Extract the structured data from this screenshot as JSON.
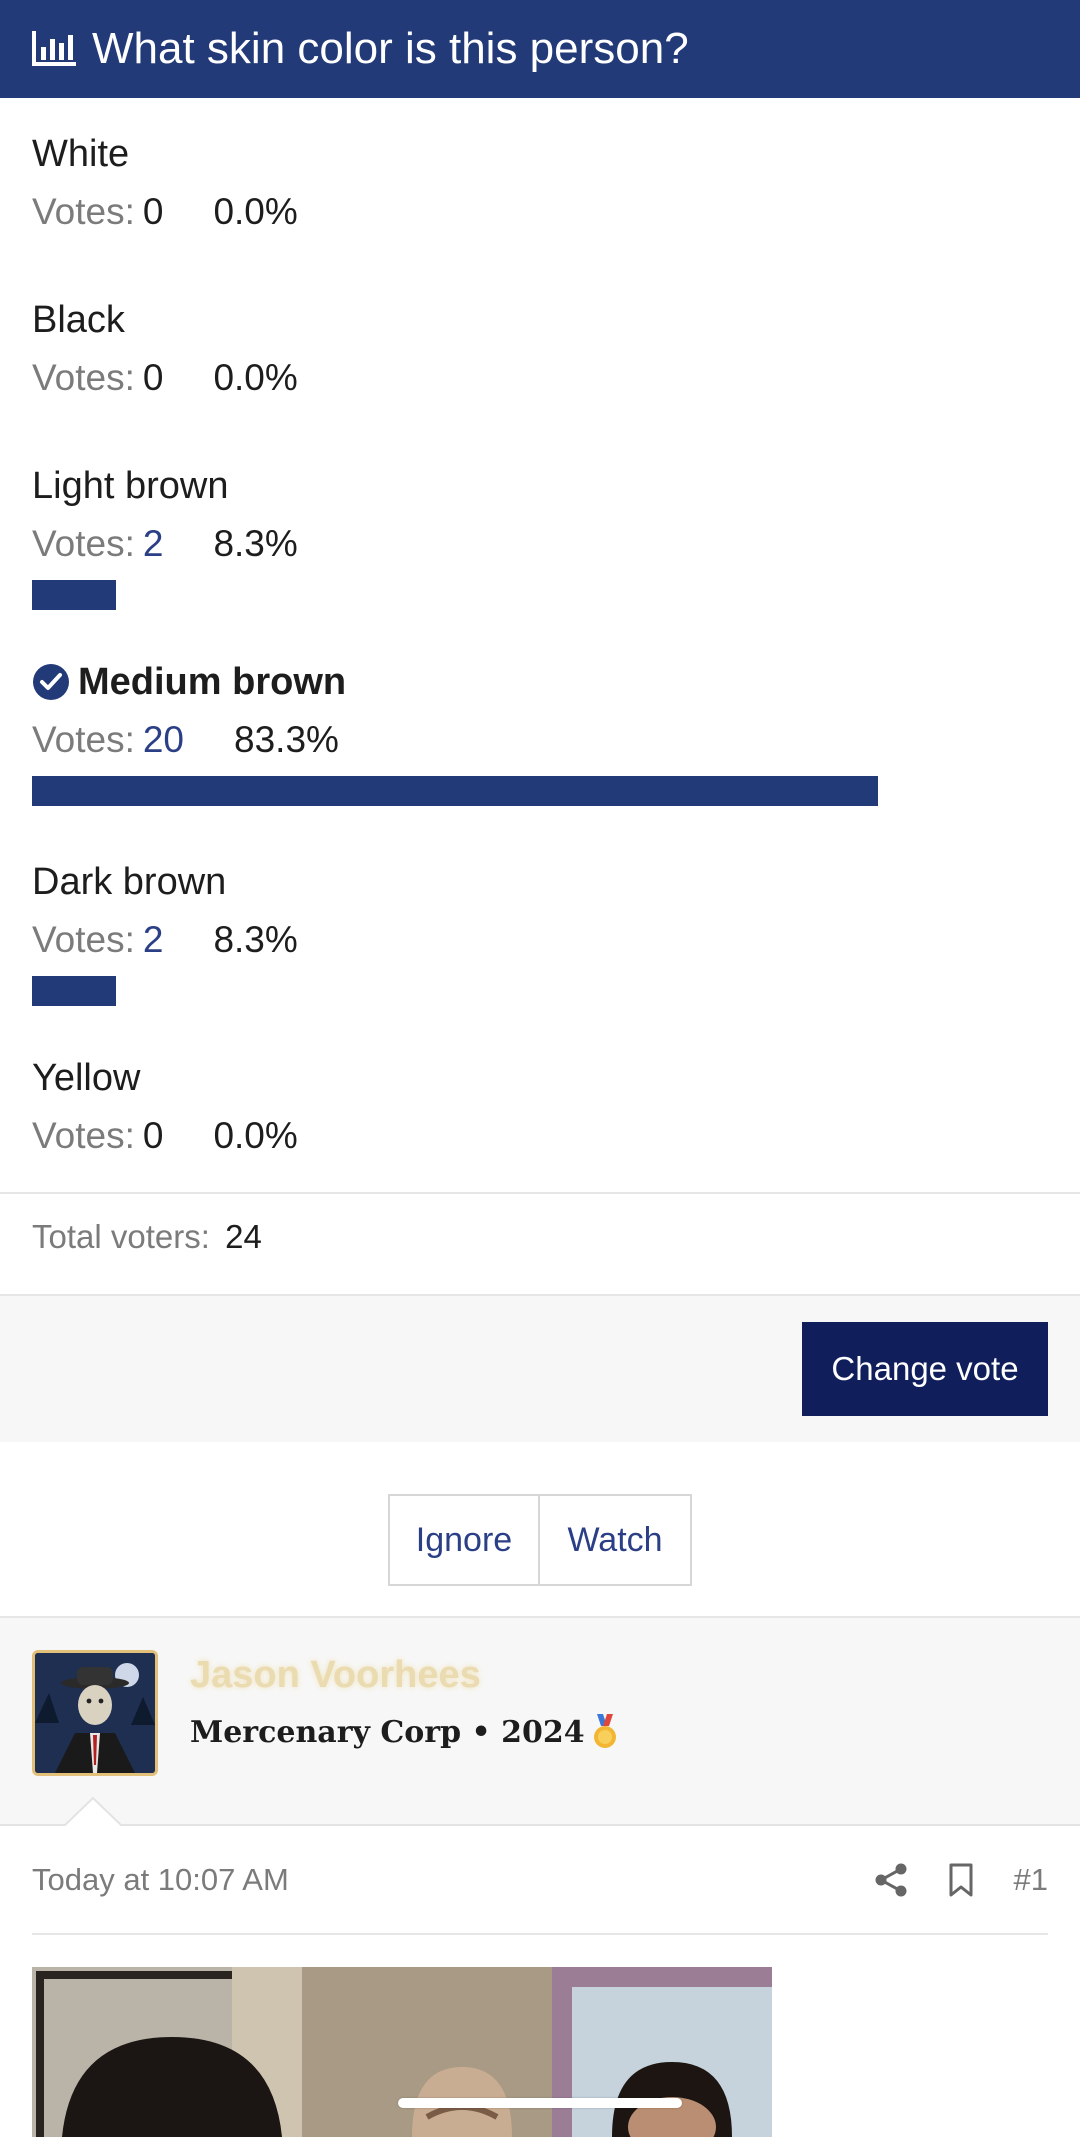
{
  "poll": {
    "title": "What skin color is this person?",
    "icon": "bar-chart-icon",
    "votes_label": "Votes:",
    "options": [
      {
        "label": "White",
        "votes": "0",
        "percent": "0.0%",
        "fraction": 0.0,
        "selected": false
      },
      {
        "label": "Black",
        "votes": "0",
        "percent": "0.0%",
        "fraction": 0.0,
        "selected": false
      },
      {
        "label": "Light brown",
        "votes": "2",
        "percent": "8.3%",
        "fraction": 0.083,
        "selected": false
      },
      {
        "label": "Medium brown",
        "votes": "20",
        "percent": "83.3%",
        "fraction": 0.833,
        "selected": true
      },
      {
        "label": "Dark brown",
        "votes": "2",
        "percent": "8.3%",
        "fraction": 0.083,
        "selected": false
      },
      {
        "label": "Yellow",
        "votes": "0",
        "percent": "0.0%",
        "fraction": 0.0,
        "selected": false
      }
    ],
    "total_label": "Total voters:",
    "total_value": "24",
    "change_vote_label": "Change vote"
  },
  "thread_actions": {
    "ignore_label": "Ignore",
    "watch_label": "Watch"
  },
  "post": {
    "author_name": "Jason Voorhees",
    "author_title": "Mercenary Corp • 2024",
    "author_badge_icon": "gold-medal-icon",
    "date": "Today at 10:07 AM",
    "post_number": "#1",
    "share_icon": "share-icon",
    "bookmark_icon": "bookmark-icon"
  },
  "colors": {
    "header_bg": "#233a78",
    "bar_fill": "#233a78",
    "button_bg": "#101f5c",
    "link": "#2a3f86",
    "author_name": "#eadbb0"
  }
}
